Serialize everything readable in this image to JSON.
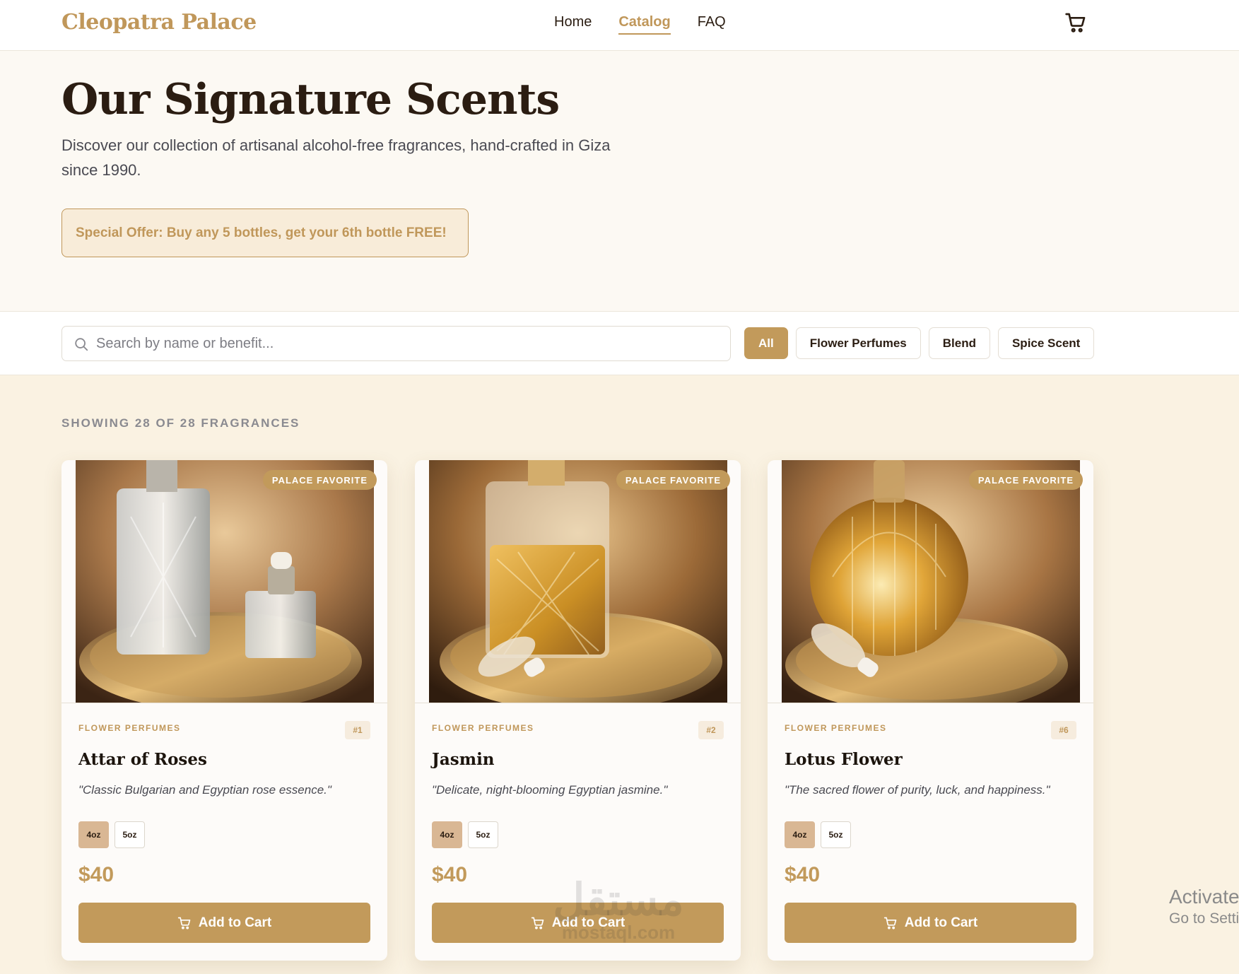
{
  "brand": "Cleopatra Palace",
  "nav": {
    "items": [
      {
        "label": "Home",
        "active": false
      },
      {
        "label": "Catalog",
        "active": true
      },
      {
        "label": "FAQ",
        "active": false
      }
    ],
    "cart_icon": "shopping-cart-icon"
  },
  "hero": {
    "title": "Our Signature Scents",
    "description": "Discover our collection of artisanal alcohol-free fragrances, hand-crafted in Giza since 1990.",
    "offer": "Special Offer: Buy any 5 bottles, get your 6th bottle FREE!"
  },
  "search": {
    "placeholder": "Search by name or benefit...",
    "value": "",
    "icon": "search-icon"
  },
  "filters": [
    {
      "label": "All",
      "active": true
    },
    {
      "label": "Flower Perfumes",
      "active": false
    },
    {
      "label": "Blend",
      "active": false
    },
    {
      "label": "Spice Scent",
      "active": false
    }
  ],
  "results": {
    "text": "SHOWING 28 OF 28 FRAGRANCES"
  },
  "products": [
    {
      "badge": "PALACE FAVORITE",
      "category": "FLOWER PERFUMES",
      "number": "#1",
      "name": "Attar of Roses",
      "tagline": "\"Classic Bulgarian and Egyptian rose essence.\"",
      "sizes": [
        "4oz",
        "5oz"
      ],
      "selected_size": "4oz",
      "price": "$40",
      "button": "Add to Cart"
    },
    {
      "badge": "PALACE FAVORITE",
      "category": "FLOWER PERFUMES",
      "number": "#2",
      "name": "Jasmin",
      "tagline": "\"Delicate, night-blooming Egyptian jasmine.\"",
      "sizes": [
        "4oz",
        "5oz"
      ],
      "selected_size": "4oz",
      "price": "$40",
      "button": "Add to Cart"
    },
    {
      "badge": "PALACE FAVORITE",
      "category": "FLOWER PERFUMES",
      "number": "#6",
      "name": "Lotus Flower",
      "tagline": "\"The sacred flower of purity, luck, and happiness.\"",
      "sizes": [
        "4oz",
        "5oz"
      ],
      "selected_size": "4oz",
      "price": "$40",
      "button": "Add to Cart"
    }
  ],
  "watermark": {
    "arabic": "مستقل",
    "latin": "mostaql.com"
  },
  "os_overlay": {
    "line1": "Activate",
    "line2": "Go to Setti"
  },
  "colors": {
    "accent": "#c29a5b",
    "hero_bg": "#fcf9f3",
    "catalog_bg": "#faf2e2",
    "text_dark": "#2b1d12",
    "size_selected": "#d9b794"
  }
}
